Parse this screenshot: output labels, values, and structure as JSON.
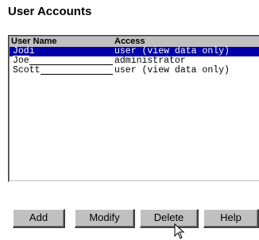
{
  "page": {
    "title": "User Accounts"
  },
  "list": {
    "columns": {
      "name": "User Name",
      "access": "Access"
    },
    "rows": [
      {
        "name": "Jodi",
        "access": "user (view data only)",
        "selected": true
      },
      {
        "name": "Joe",
        "access": "administrator",
        "selected": false
      },
      {
        "name": "Scott",
        "access": "user (view data only)",
        "selected": false
      }
    ]
  },
  "buttons": {
    "add": "Add",
    "modify": "Modify",
    "delete": "Delete",
    "help": "Help"
  },
  "icons": {
    "cursor": "arrow-cursor-icon"
  },
  "colors": {
    "selection": "#0000a8",
    "button_face": "#c0c0c0"
  }
}
